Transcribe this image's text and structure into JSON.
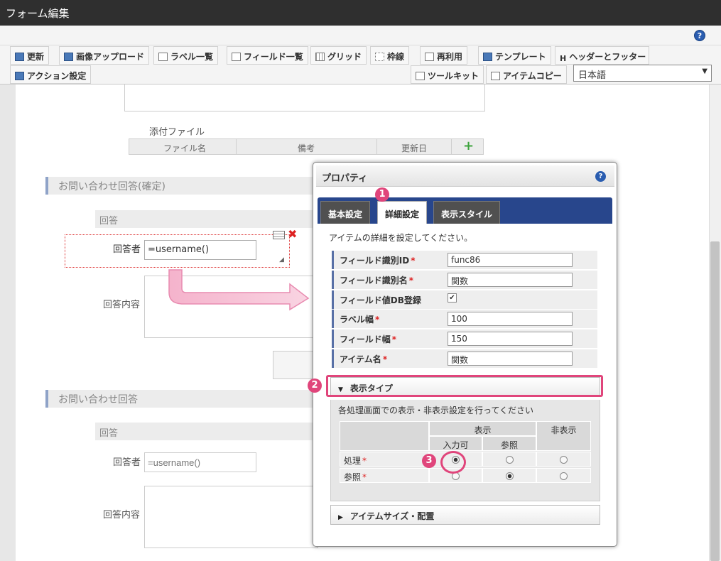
{
  "window": {
    "title": "フォーム編集"
  },
  "toolbar": {
    "row1": [
      "更新",
      "画像アップロード",
      "ラベル一覧",
      "フィールド一覧",
      "グリッド",
      "枠線",
      "再利用",
      "テンプレート",
      "ヘッダーとフッター"
    ],
    "h_glyph": "H",
    "row2_left": "アクション設定",
    "toolkit": "ツールキット",
    "item_copy": "アイテムコピー",
    "language": "日本語",
    "help": "?"
  },
  "form": {
    "attach_label": "添付ファイル",
    "attach_cols": [
      "ファイル名",
      "備考",
      "更新日"
    ],
    "attach_add": "+",
    "section1": "お問い合わせ回答(確定)",
    "sub1": "回答",
    "respondent_label": "回答者",
    "respondent_value": "=username()",
    "content_label": "回答内容",
    "section2": "お問い合わせ回答",
    "sub2": "回答",
    "respondent2_label": "回答者",
    "respondent2_placeholder": "=username()",
    "content2_label": "回答内容"
  },
  "dialog": {
    "title": "プロパティ",
    "help": "?",
    "tabs": [
      "基本設定",
      "詳細設定",
      "表示スタイル"
    ],
    "active_tab": "詳細設定",
    "description": "アイテムの詳細を設定してください。",
    "props": [
      {
        "label": "フィールド識別ID",
        "required": true,
        "value": "func86"
      },
      {
        "label": "フィールド識別名",
        "required": true,
        "value": "関数"
      },
      {
        "label": "フィールド値DB登録",
        "required": false,
        "checkbox": true,
        "checked": true
      },
      {
        "label": "ラベル幅",
        "required": true,
        "value": "100"
      },
      {
        "label": "フィールド幅",
        "required": true,
        "value": "150"
      },
      {
        "label": "アイテム名",
        "required": true,
        "value": "関数"
      }
    ],
    "required_mark": "*",
    "display_type": {
      "title": "表示タイプ",
      "description": "各処理画面での表示・非表示設定を行ってください",
      "col_show": "表示",
      "col_hide": "非表示",
      "col_input": "入力可",
      "col_ref": "参照",
      "rows": [
        {
          "label": "処理",
          "selected": "入力可"
        },
        {
          "label": "参照",
          "selected": "参照"
        }
      ]
    },
    "item_size": "アイテムサイズ・配置"
  },
  "annotations": [
    "1",
    "2",
    "3"
  ],
  "colors": {
    "accent": "#e0457b",
    "tabbar": "#28468c"
  }
}
